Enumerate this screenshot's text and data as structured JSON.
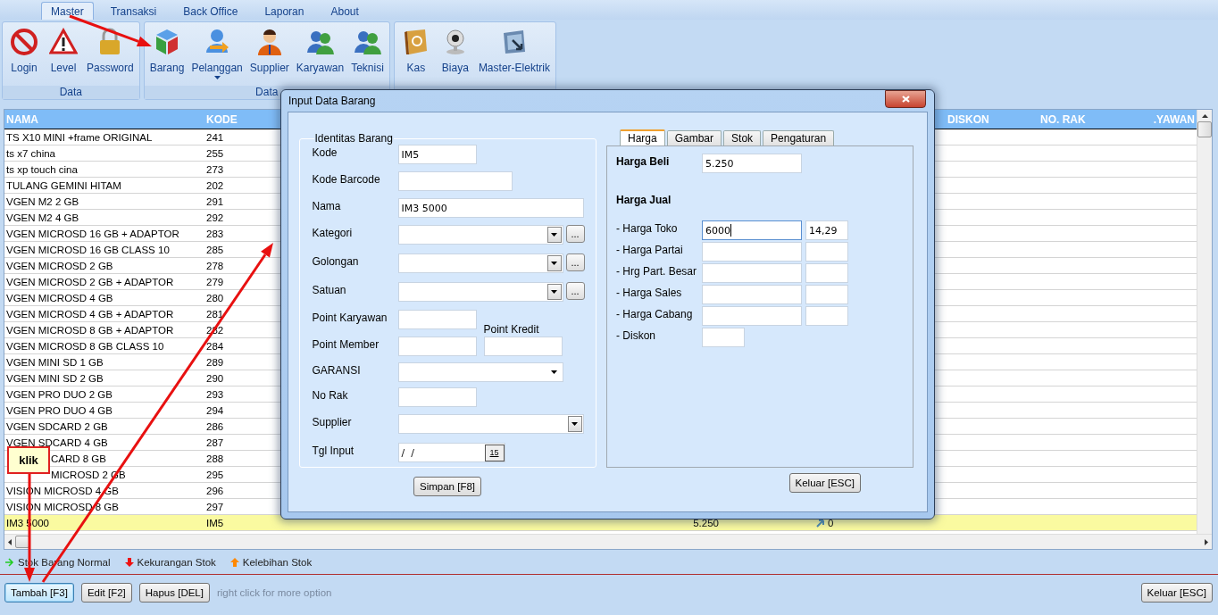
{
  "ribbon": {
    "tabs": [
      {
        "label": "Master",
        "selected": true
      },
      {
        "label": "Transaksi",
        "selected": false
      },
      {
        "label": "Back Office",
        "selected": false
      },
      {
        "label": "Laporan",
        "selected": false
      },
      {
        "label": "About",
        "selected": false
      }
    ],
    "groups": [
      {
        "label": "Data",
        "items": [
          {
            "label": "Login",
            "dropdown": false
          },
          {
            "label": "Level",
            "dropdown": false
          },
          {
            "label": "Password",
            "dropdown": false
          }
        ]
      },
      {
        "label": "Data",
        "items": [
          {
            "label": "Barang",
            "dropdown": false
          },
          {
            "label": "Pelanggan",
            "dropdown": true
          },
          {
            "label": "Supplier",
            "dropdown": false
          },
          {
            "label": "Karyawan",
            "dropdown": false
          },
          {
            "label": "Teknisi",
            "dropdown": false
          }
        ]
      },
      {
        "items": [
          {
            "label": "Kas",
            "dropdown": false
          },
          {
            "label": "Biaya",
            "dropdown": false
          },
          {
            "label": "Master-Elektrik",
            "dropdown": false
          }
        ]
      }
    ]
  },
  "table": {
    "header": {
      "nama": "NAMA",
      "kode": "KODE",
      "diskon": "DISKON",
      "no_rak": "NO. RAK",
      "column_8": ".YAWAN"
    },
    "rows": [
      {
        "nama": "TS X10 MINI +frame ORIGINAL",
        "kode": "241",
        "selected": false
      },
      {
        "nama": "ts x7 china",
        "kode": "255",
        "selected": false
      },
      {
        "nama": "ts xp touch cina",
        "kode": "273",
        "selected": false
      },
      {
        "nama": "TULANG GEMINI HITAM",
        "kode": "202",
        "selected": false
      },
      {
        "nama": "VGEN M2 2 GB",
        "kode": "291",
        "selected": false
      },
      {
        "nama": "VGEN M2 4 GB",
        "kode": "292",
        "selected": false
      },
      {
        "nama": "VGEN MICROSD 16 GB + ADAPTOR",
        "kode": "283",
        "selected": false
      },
      {
        "nama": "VGEN MICROSD 16 GB CLASS 10",
        "kode": "285",
        "selected": false
      },
      {
        "nama": "VGEN MICROSD 2 GB",
        "kode": "278",
        "selected": false
      },
      {
        "nama": "VGEN MICROSD 2 GB + ADAPTOR",
        "kode": "279",
        "selected": false
      },
      {
        "nama": "VGEN MICROSD 4 GB",
        "kode": "280",
        "selected": false
      },
      {
        "nama": "VGEN MICROSD 4 GB + ADAPTOR",
        "kode": "281",
        "selected": false
      },
      {
        "nama": "VGEN MICROSD 8 GB + ADAPTOR",
        "kode": "282",
        "selected": false
      },
      {
        "nama": "VGEN MICROSD 8 GB CLASS 10",
        "kode": "284",
        "selected": false
      },
      {
        "nama": "VGEN MINI SD 1 GB",
        "kode": "289",
        "selected": false
      },
      {
        "nama": "VGEN MINI SD 2 GB",
        "kode": "290",
        "selected": false
      },
      {
        "nama": "VGEN PRO DUO 2 GB",
        "kode": "293",
        "selected": false
      },
      {
        "nama": "VGEN PRO DUO 4 GB",
        "kode": "294",
        "selected": false
      },
      {
        "nama": "VGEN SDCARD 2 GB",
        "kode": "286",
        "selected": false
      },
      {
        "nama": "VGEN SDCARD 4 GB",
        "kode": "287",
        "selected": false
      },
      {
        "nama": "CARD 8 GB",
        "kode": "288",
        "selected": false,
        "partly_covered": true
      },
      {
        "nama": "MICROSD 2 GB",
        "kode": "295",
        "selected": false,
        "partly_covered": true
      },
      {
        "nama": "VISION MICROSD 4 GB",
        "kode": "296",
        "selected": false
      },
      {
        "nama": "VISION MICROSD 8 GB",
        "kode": "297",
        "selected": false
      },
      {
        "nama": "IM3 5000",
        "kode": "IM5",
        "column_3": "5.250",
        "column_5": "0",
        "selected": true
      }
    ]
  },
  "legend": [
    {
      "label": "Stok Barang Normal",
      "kind": "right",
      "color": "#22cc22"
    },
    {
      "label": "Kekurangan Stok",
      "kind": "down",
      "color": "#ee1111"
    },
    {
      "label": "Kelebihan Stok",
      "kind": "up",
      "color": "#ff8800"
    }
  ],
  "buttons": [
    {
      "label": "Tambah [F3]",
      "focused": true
    },
    {
      "label": "Edit [F2]",
      "focused": false
    },
    {
      "label": "Hapus [DEL]",
      "focused": false
    }
  ],
  "hint": "right click for more option",
  "exit_button": "Keluar [ESC]",
  "callout": "klik",
  "dialog": {
    "title": "Input Data Barang",
    "group_title": "Identitas Barang",
    "fields": [
      {
        "kind": "short",
        "label": "Kode",
        "value": "IM5"
      },
      {
        "kind": "medium",
        "label": "Kode Barcode"
      },
      {
        "kind": "long",
        "label": "Nama",
        "value": "IM3 5000"
      },
      {
        "kind": "combo",
        "label": "Kategori",
        "browse": "..."
      },
      {
        "kind": "combo",
        "label": "Golongan",
        "browse": "..."
      },
      {
        "kind": "combo",
        "label": "Satuan",
        "browse": "..."
      },
      {
        "kind": "points",
        "labels": [
          "Point Karyawan",
          "Point Member"
        ],
        "side_label": "Point Kredit"
      },
      {
        "kind": "select",
        "label": "GARANSI"
      },
      {
        "kind": "short",
        "label": "No Rak"
      },
      {
        "kind": "lookup",
        "label": "Supplier"
      },
      {
        "kind": "date",
        "label": "Tgl Input",
        "value": "/  /",
        "calendar": "15"
      }
    ],
    "tabs": [
      {
        "label": "Harga",
        "selected": true
      },
      {
        "label": "Gambar",
        "selected": false
      },
      {
        "label": "Stok",
        "selected": false
      },
      {
        "label": "Pengaturan",
        "selected": false
      }
    ],
    "harga_beli": {
      "label": "Harga Beli",
      "value": "5.250"
    },
    "harga_jual_title": "Harga Jual",
    "prices": [
      {
        "label": "- Harga Toko",
        "value": "6000",
        "percent": "14,29",
        "focused": true
      },
      {
        "label": "- Harga Partai",
        "focused": false
      },
      {
        "label": "- Hrg Part. Besar",
        "focused": false
      },
      {
        "label": "- Harga Sales",
        "focused": false
      },
      {
        "label": "- Harga Cabang",
        "focused": false
      }
    ],
    "diskon": {
      "label": "- Diskon"
    },
    "save_button": "Simpan [F8]",
    "exit_button": "Keluar [ESC]"
  }
}
